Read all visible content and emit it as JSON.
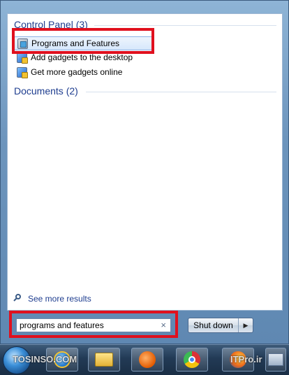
{
  "control_panel": {
    "header": "Control Panel (3)",
    "items": [
      {
        "label": "Programs and Features",
        "icon": "programs-features-icon"
      },
      {
        "label": "Add gadgets to the desktop",
        "icon": "gadgets-icon"
      },
      {
        "label": "Get more gadgets online",
        "icon": "gadgets-icon"
      }
    ]
  },
  "documents": {
    "header": "Documents (2)"
  },
  "see_more": {
    "label": "See more results",
    "icon": "search-icon"
  },
  "search": {
    "value": "programs and features",
    "clear_icon": "×"
  },
  "shutdown": {
    "label": "Shut down",
    "arrow": "▶"
  },
  "watermarks": {
    "left": "TOSINSO.COM",
    "right": "ITPro.ir"
  },
  "colors": {
    "highlight": "#e0101e",
    "header_text": "#1e3d8f",
    "selected_border": "#8db2e3"
  }
}
